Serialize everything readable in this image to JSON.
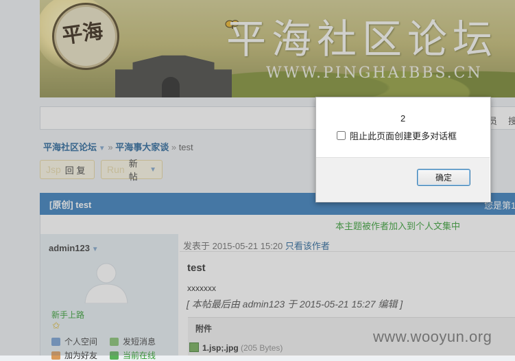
{
  "banner": {
    "logo_text": "平海",
    "title": "平海社区论坛",
    "url": "WWW.PINGHAIBBS.CN"
  },
  "nav": {
    "member_fragment": "员",
    "search_fragment": "搜"
  },
  "breadcrumb": {
    "forum": "平海社区论坛",
    "section": "平海事大家谈",
    "sep": "»",
    "current": "test"
  },
  "toolbar": {
    "reply_prefix": "Jsp",
    "reply_label": "回 复",
    "new_prefix": "Run",
    "new_label": "新 帖"
  },
  "thread": {
    "title": "[原创] test",
    "right_fragment": "您是第1",
    "collected_notice": "本主题被作者加入到个人文集中"
  },
  "user": {
    "name": "admin123",
    "rank": "新手上路",
    "links": [
      "个人空间",
      "发短消息",
      "加为好友",
      "当前在线"
    ]
  },
  "post": {
    "meta": "发表于 2015-05-21 15:20",
    "only_author": "只看该作者",
    "title": "test",
    "body": "xxxxxxx",
    "edit_note": "[ 本帖最后由 admin123 于 2015-05-21  15:27 编辑 ]",
    "attachment_label": "附件",
    "attachment_name": "1.jsp;.jpg",
    "attachment_size": "(205 Bytes)"
  },
  "dialog": {
    "message": "2",
    "checkbox_label": "阻止此页面创建更多对话框",
    "ok_label": "确定"
  },
  "watermark": "www.wooyun.org"
}
